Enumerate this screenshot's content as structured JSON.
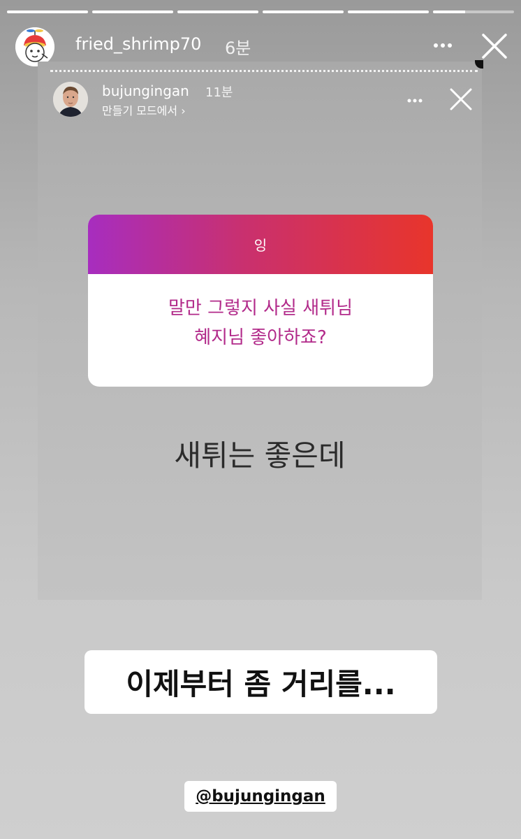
{
  "progress": [
    1,
    1,
    1,
    1,
    1,
    0.4
  ],
  "outer": {
    "username": "fried_shrimp70",
    "time": "6분",
    "avatar_icon": "cartoon-propeller-hat-avatar"
  },
  "embedded_story": {
    "username": "bujungingan",
    "time": "11분",
    "subtitle": "만들기 모드에서 ›",
    "avatar_icon": "man-portrait-avatar",
    "question_prompt": "잉",
    "question_line1": "말만 그렇지 사실 새튀님",
    "question_line2": "혜지님 좋아하죠?",
    "answer": "새튀는 좋은데",
    "gradient_colors": [
      "#a72dbf",
      "#c9306f",
      "#e8352b"
    ]
  },
  "caption": "이제부터 좀 거리를...",
  "mention": "@bujungingan"
}
